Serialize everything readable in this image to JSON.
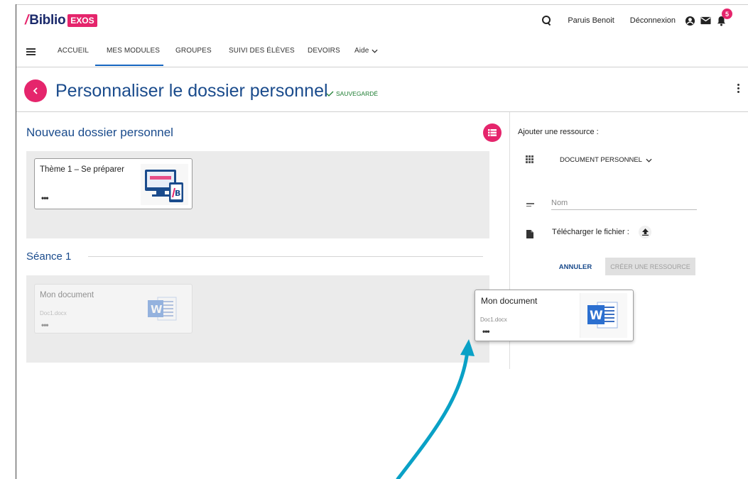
{
  "header": {
    "logo_slash": "/",
    "logo_text": "Biblio",
    "logo_badge": "EXOS",
    "user_name": "Paruis Benoit",
    "logout": "Déconnexion",
    "notification_count": "5",
    "icons": [
      "search-icon",
      "account-icon",
      "mail-icon",
      "bell-icon"
    ]
  },
  "nav": {
    "items": [
      "ACCUEIL",
      "MES MODULES",
      "GROUPES",
      "SUIVI DES ÉLÈVES",
      "DEVOIRS",
      "Aide"
    ],
    "active": "MES MODULES"
  },
  "page": {
    "title": "Personnaliser le dossier personnel",
    "saved_status": "SAUVEGARDÉ"
  },
  "folder": {
    "title": "Nouveau dossier personnel",
    "card": {
      "title": "Thème 1 – Se préparer",
      "more": "•••",
      "thumb_badge": "BiblioEXOS"
    }
  },
  "seance": {
    "title": "Séance 1",
    "ghost_card": {
      "title": "Mon document",
      "filename": "Doc1.docx",
      "more": "•••"
    }
  },
  "drag_card": {
    "title": "Mon document",
    "filename": "Doc1.docx",
    "more": "•••"
  },
  "resource_panel": {
    "label": "Ajouter une ressource :",
    "type_select": "DOCUMENT PERSONNEL",
    "name_placeholder": "Nom",
    "upload_label": "Télécharger le fichier :",
    "cancel": "ANNULER",
    "create": "CRÉER UNE RESSOURCE"
  },
  "colors": {
    "accent": "#e5256c",
    "primary_text": "#1a4b8c",
    "nav_active": "#1565c0",
    "saved": "#1e7d32",
    "annotation_arrow": "#0aa1c6",
    "word_blue": "#2b6fd0"
  }
}
